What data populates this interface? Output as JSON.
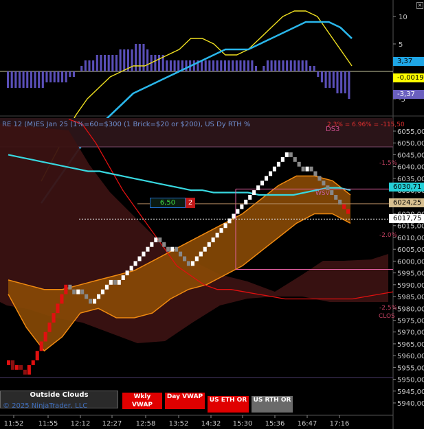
{
  "header": {
    "title": "RE 12 (M)ES Jan 25 (1%=60=$300  (1 Brick=$20 or $200), US Dy RTH %",
    "ds3": "DS3",
    "pnl": "2.3% = 6.96% = -115,50",
    "pct_labels": [
      "-1.5%",
      "-2.0%",
      "-2.5%"
    ],
    "close_label": "CLOS",
    "vwap_label": "WSV"
  },
  "order_box": {
    "qty": "6,50",
    "count": "2"
  },
  "axis_upper": {
    "ticks": [
      "10",
      "5",
      "-5"
    ]
  },
  "axis_lower": {
    "ticks": [
      "6055,00",
      "6050,00",
      "6045,00",
      "6040,00",
      "6035,00",
      "6030,00",
      "6025,00",
      "6020,00",
      "6015,00",
      "6010,00",
      "6005,00",
      "6000,00",
      "5995,00",
      "5990,00",
      "5985,00",
      "5980,00",
      "5975,00",
      "5970,00",
      "5965,00",
      "5960,00",
      "5955,00",
      "5950,00",
      "5945,00",
      "5940,00"
    ]
  },
  "price_tags": {
    "upper_a": "3,37",
    "upper_b": "-0,00192",
    "upper_c": "-3,37",
    "cyan": "6030,71",
    "price": "6024,25",
    "white": "6017,75",
    "hidden": "6020,00"
  },
  "time_axis": [
    "11:52",
    "11:55",
    "12:12",
    "12:27",
    "12:58",
    "13:52",
    "14:32",
    "15:30",
    "15:36",
    "16:47",
    "17:16"
  ],
  "buttons": {
    "outside": "Outside Clouds",
    "wkly": "Wkly VWAP",
    "day": "Day VWAP",
    "eth": "US ETH OR",
    "rth": "US RTH OR"
  },
  "copyright": "© 2025 NinjaTrader, LLC",
  "colors": {
    "accent_cyan": "#3fc0f0",
    "cloud_orange": "#8a4a05",
    "cloud_dark": "#3a1212",
    "bull": "#ffffff",
    "bear": "#888888",
    "red": "#e01010"
  },
  "chart_data": [
    {
      "type": "line",
      "title": "",
      "series": [
        {
          "values": [
            -20,
            -16,
            -12,
            -8,
            -5,
            -3,
            -1,
            0,
            1,
            1,
            2,
            3,
            4,
            6,
            6,
            5,
            3,
            3,
            4,
            6,
            8,
            10,
            11,
            11,
            10,
            7,
            4,
            1
          ]
        },
        {
          "values": [
            -24,
            -21,
            -18,
            -15,
            -12,
            -10,
            -8,
            -6,
            -4,
            -3,
            -2,
            -1,
            0,
            1,
            2,
            3,
            4,
            4,
            4,
            5,
            6,
            7,
            8,
            9,
            9,
            9,
            8,
            6
          ]
        }
      ],
      "histogram": [
        -3,
        -3,
        -3,
        -3,
        -3,
        -3,
        -3,
        -3,
        -3,
        -3,
        -2,
        -2,
        -2,
        -2,
        -2,
        -2,
        -1,
        -1,
        0,
        1,
        2,
        2,
        2,
        3,
        3,
        3,
        3,
        3,
        3,
        4,
        4,
        4,
        4,
        5,
        5,
        5,
        4,
        3,
        3,
        3,
        3,
        2,
        2,
        2,
        2,
        2,
        2,
        2,
        2,
        2,
        2,
        2,
        2,
        2,
        2,
        2,
        2,
        2,
        2,
        2,
        2,
        2,
        2,
        2,
        1,
        0,
        1,
        2,
        2,
        2,
        2,
        2,
        2,
        2,
        2,
        2,
        2,
        2,
        1,
        1,
        -1,
        -2,
        -3,
        -3,
        -3,
        -4,
        -4,
        -4,
        -5
      ],
      "ylim": [
        -8,
        13
      ]
    },
    {
      "type": "renko",
      "bricks": [
        5958,
        5954,
        5956,
        5954,
        5952,
        5956,
        5958,
        5962,
        5966,
        5970,
        5974,
        5978,
        5982,
        5986,
        5990,
        5988,
        5986,
        5988,
        5986,
        5984,
        5982,
        5984,
        5986,
        5988,
        5990,
        5992,
        5990,
        5992,
        5994,
        5996,
        5998,
        6000,
        6002,
        6004,
        6006,
        6008,
        6010,
        6008,
        6006,
        6004,
        6006,
        6004,
        6002,
        6000,
        5998,
        6000,
        6002,
        6004,
        6006,
        6008,
        6010,
        6012,
        6014,
        6016,
        6018,
        6020,
        6022,
        6024,
        6026,
        6028,
        6030,
        6032,
        6034,
        6036,
        6038,
        6040,
        6042,
        6044,
        6046,
        6044,
        6042,
        6040,
        6038,
        6040,
        6038,
        6036,
        6034,
        6032,
        6030,
        6028,
        6026,
        6024,
        6022,
        6020
      ],
      "cyan_line": [
        6045,
        6044,
        6043,
        6042,
        6041,
        6040,
        6039,
        6038,
        6038,
        6037,
        6036,
        6035,
        6034,
        6033,
        6032,
        6031,
        6030,
        6030,
        6029,
        6029,
        6029,
        6029,
        6028,
        6028,
        6028,
        6028,
        6029,
        6030,
        6031,
        6031,
        6030
      ],
      "red_line": [
        6060,
        6058,
        6050,
        6040,
        6030,
        6022,
        6014,
        6006,
        5998,
        5994,
        5990,
        5988,
        5988,
        5987,
        5986,
        5985,
        5984,
        5984,
        5984,
        5984,
        5984,
        5984,
        5985,
        5986,
        5987
      ],
      "cloud_upper": [
        5992,
        5990,
        5988,
        5988,
        5990,
        5992,
        5994,
        5996,
        6000,
        6004,
        6008,
        6012,
        6016,
        6020,
        6026,
        6032,
        6036,
        6036,
        6034,
        6028
      ],
      "cloud_lower": [
        5986,
        5972,
        5962,
        5968,
        5978,
        5980,
        5976,
        5976,
        5978,
        5984,
        5988,
        5990,
        5994,
        5998,
        6004,
        6010,
        6016,
        6020,
        6020,
        6016
      ],
      "ylim": [
        5938,
        6058
      ]
    }
  ]
}
